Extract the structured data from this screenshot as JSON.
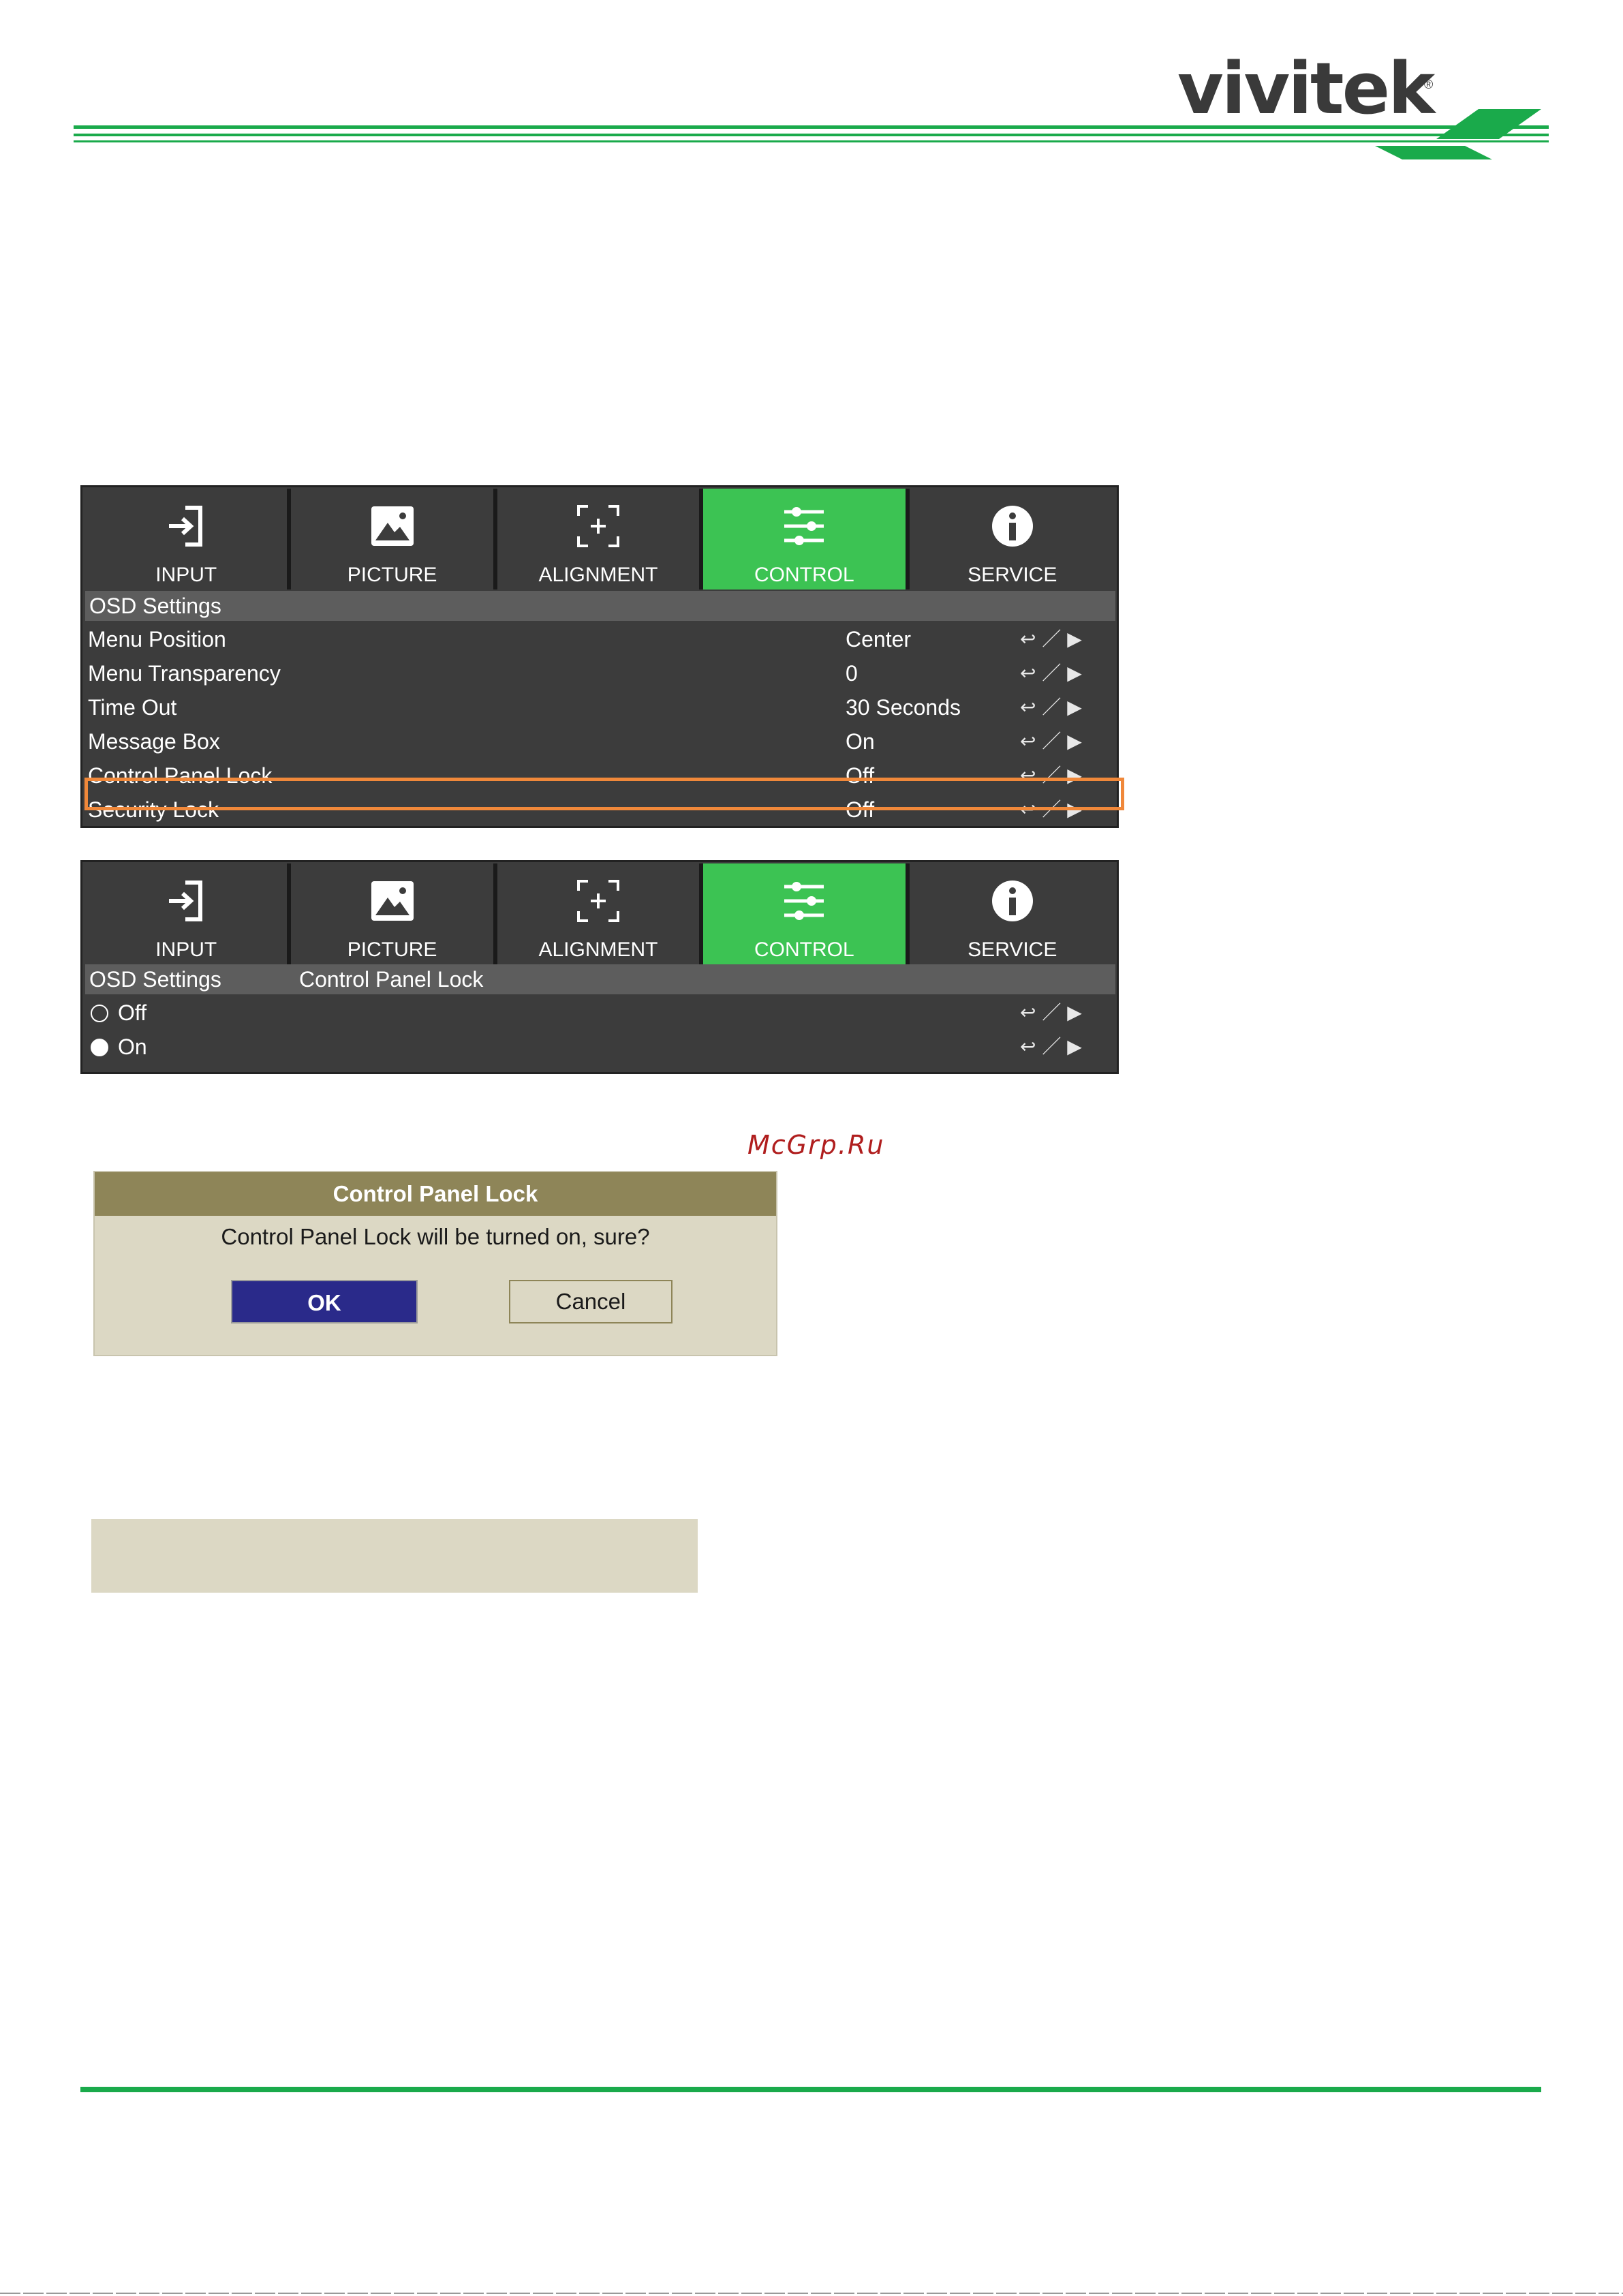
{
  "header": {
    "brand": "vivitek",
    "registered": "®",
    "accent_color": "#1aaa4b"
  },
  "osd_main": {
    "tabs": [
      {
        "label": "INPUT",
        "icon": "input-arrow-icon",
        "active": false
      },
      {
        "label": "PICTURE",
        "icon": "picture-icon",
        "active": false
      },
      {
        "label": "ALIGNMENT",
        "icon": "alignment-icon",
        "active": false
      },
      {
        "label": "CONTROL",
        "icon": "sliders-icon",
        "active": true
      },
      {
        "label": "SERVICE",
        "icon": "info-icon",
        "active": false
      }
    ],
    "section": "OSD Settings",
    "rows": [
      {
        "label": "Menu Position",
        "value": "Center",
        "nav": "↩ ／ ▶"
      },
      {
        "label": "Menu Transparency",
        "value": "0",
        "nav": "↩ ／ ▶"
      },
      {
        "label": "Time Out",
        "value": "30 Seconds",
        "nav": "↩ ／ ▶"
      },
      {
        "label": "Message Box",
        "value": "On",
        "nav": "↩ ／ ▶"
      },
      {
        "label": "Control Panel Lock",
        "value": "Off",
        "nav": "↩ ／ ▶"
      },
      {
        "label": "Security Lock",
        "value": "Off",
        "nav": "↩ ／ ▶"
      }
    ],
    "active_color": "#3cc353",
    "highlight_color": "#f0883a"
  },
  "osd_sub": {
    "tabs": [
      {
        "label": "INPUT"
      },
      {
        "label": "PICTURE"
      },
      {
        "label": "ALIGNMENT"
      },
      {
        "label": "CONTROL"
      },
      {
        "label": "SERVICE"
      }
    ],
    "section": "OSD Settings",
    "subsection": "Control Panel Lock",
    "options": [
      {
        "label": "Off",
        "selected": false,
        "nav": "↩ ／ ▶"
      },
      {
        "label": "On",
        "selected": true,
        "nav": "↩ ／ ▶"
      }
    ]
  },
  "watermark": "McGrp.Ru",
  "dialog": {
    "title": "Control Panel Lock",
    "message": "Control Panel Lock will be turned on, sure?",
    "ok_label": "OK",
    "cancel_label": "Cancel"
  }
}
